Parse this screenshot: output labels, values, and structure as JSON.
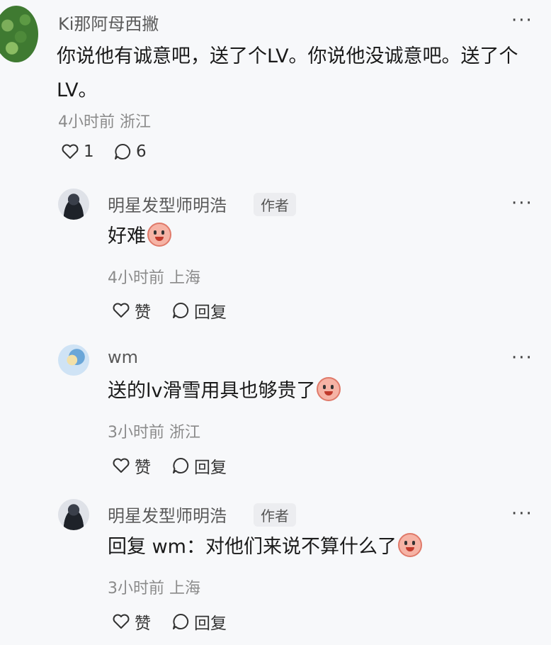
{
  "post": {
    "author": "Ki那阿母西撇",
    "text_line1": "你说他有诚意吧，送了个LV。你说他没诚意吧。送了个",
    "text_line2": "LV。",
    "meta": "4小时前 浙江",
    "likes": "1",
    "comments": "6",
    "more": "···"
  },
  "replies": [
    {
      "author": "明星发型师明浩",
      "badge": "作者",
      "text": "好难",
      "emoji": "crying-face",
      "meta": "4小时前 上海",
      "like_label": "赞",
      "reply_label": "回复",
      "more": "···"
    },
    {
      "author": "wm",
      "text": "送的lv滑雪用具也够贵了",
      "emoji": "crying-face",
      "meta": "3小时前 浙江",
      "like_label": "赞",
      "reply_label": "回复",
      "more": "···"
    },
    {
      "author": "明星发型师明浩",
      "badge": "作者",
      "text": "回复 wm：对他们来说不算什么了",
      "emoji": "crying-face",
      "meta": "3小时前 上海",
      "like_label": "赞",
      "reply_label": "回复",
      "more": "···"
    }
  ]
}
